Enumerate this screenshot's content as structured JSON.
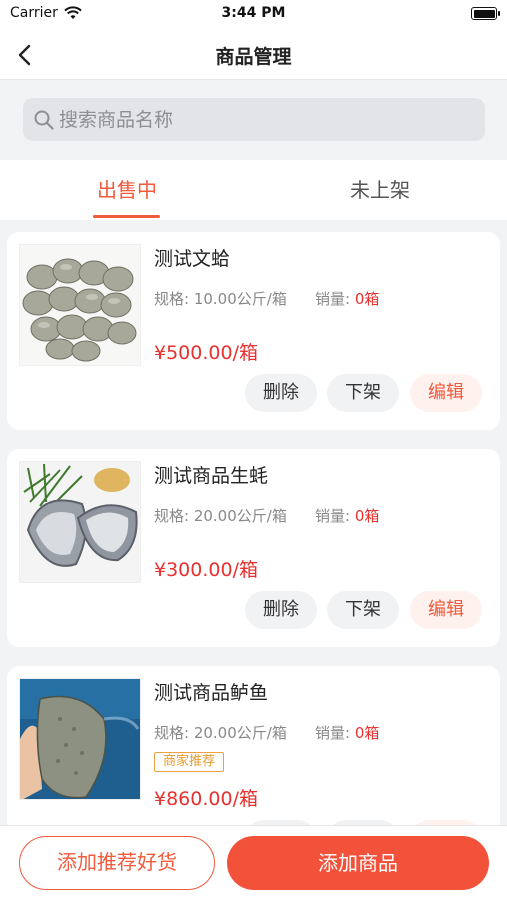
{
  "status_bar": {
    "carrier": "Carrier",
    "time": "3:44 PM"
  },
  "nav": {
    "title": "商品管理"
  },
  "search": {
    "placeholder": "搜索商品名称"
  },
  "tabs": [
    {
      "label": "出售中"
    },
    {
      "label": "未上架"
    }
  ],
  "products": [
    {
      "name": "测试文蛤",
      "spec": "规格: 10.00公斤/箱",
      "sales_label": "销量: ",
      "sales_value": "0箱",
      "price": "¥500.00/箱",
      "image": "clams-image"
    },
    {
      "name": "测试商品生蚝",
      "spec": "规格: 20.00公斤/箱",
      "sales_label": "销量: ",
      "sales_value": "0箱",
      "price": "¥300.00/箱",
      "image": "oysters-image"
    },
    {
      "name": "测试商品鲈鱼",
      "spec": "规格: 20.00公斤/箱",
      "sales_label": "销量: ",
      "sales_value": "0箱",
      "badge": "商家推荐",
      "price": "¥860.00/箱",
      "image": "sea-bass-image"
    }
  ],
  "actions": {
    "delete": "删除",
    "unlist": "下架",
    "edit": "编辑"
  },
  "bottom": {
    "add_recommended": "添加推荐好货",
    "add_product": "添加商品"
  },
  "colors": {
    "accent": "#f15a3c",
    "price": "#e8312f",
    "badge": "#e89a2e"
  }
}
